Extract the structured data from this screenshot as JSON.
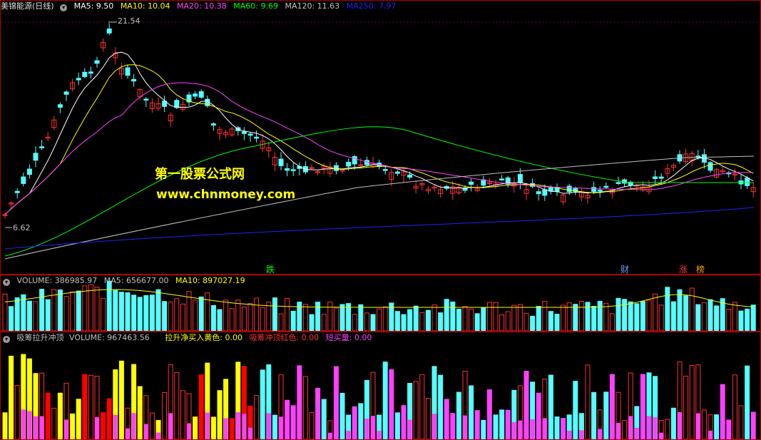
{
  "main": {
    "stock_name": "美锦能源(日线)",
    "indicators": [
      {
        "label": "MA5: 9.50",
        "color": "#ffffff"
      },
      {
        "label": "MA10: 10.04",
        "color": "#ffff00"
      },
      {
        "label": "MA20: 10.38",
        "color": "#ff40ff"
      },
      {
        "label": "MA60: 9.69",
        "color": "#00ff00"
      },
      {
        "label": "MA120: 11.63",
        "color": "#c0c0c0"
      },
      {
        "label": "MA250: 7.97",
        "color": "#2020ff"
      }
    ],
    "high_label": "21.54",
    "low_label": "6.62",
    "events": [
      "跌",
      "财",
      "涨",
      "榜"
    ]
  },
  "volume": {
    "label": "VOLUME: 386985.97",
    "ma5": "MA5: 656677.00",
    "ma10": "MA10: 897027.19"
  },
  "indicator": {
    "name": "吸筹拉升冲顶",
    "volume": "VOLUME: 967463.56",
    "yellow": "拉升净买入黄色: 0.00",
    "red": "吸筹冲顶红色: 0.00",
    "magenta": "短买量: 0.00"
  },
  "watermark": {
    "line1": "第一股票公式网",
    "line2": "www.chnmoney.com"
  },
  "colors": {
    "up": "#ff3232",
    "down": "#54ffff",
    "grid": "#b00000"
  }
}
